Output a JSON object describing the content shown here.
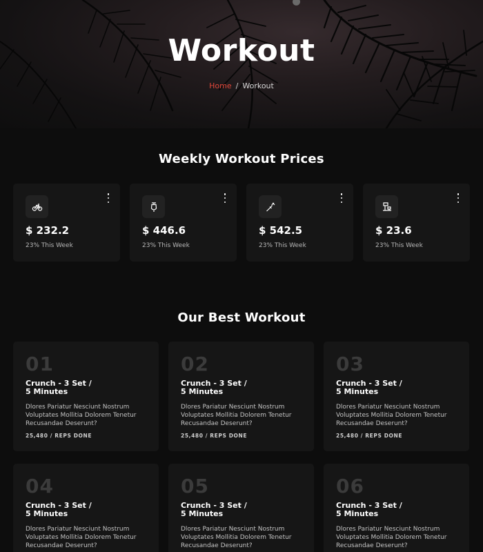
{
  "hero": {
    "title": "Workout",
    "breadcrumb": {
      "home": "Home",
      "separator": "/",
      "current": "Workout"
    }
  },
  "prices": {
    "title": "Weekly Workout Prices",
    "cards": [
      {
        "icon": "bicycle-icon",
        "value": "$ 232.2",
        "trend": "23% This Week"
      },
      {
        "icon": "kettlebell-icon",
        "value": "$ 446.6",
        "trend": "23% This Week"
      },
      {
        "icon": "jump-rope-icon",
        "value": "$ 542.5",
        "trend": "23% This Week"
      },
      {
        "icon": "exercise-machine-icon",
        "value": "$ 23.6",
        "trend": "23% This Week"
      }
    ]
  },
  "workouts": {
    "title": "Our Best Workout",
    "cards": [
      {
        "number": "01",
        "title_line1": "Crunch - 3 Set /",
        "title_line2": "5 Minutes",
        "desc": "Dlores Pariatur Nesciunt Nostrum Voluptates Mollitia Dolorem Tenetur Recusandae Deserunt?",
        "reps": "25,480 / REPS DONE"
      },
      {
        "number": "02",
        "title_line1": "Crunch - 3 Set /",
        "title_line2": "5 Minutes",
        "desc": "Dlores Pariatur Nesciunt Nostrum Voluptates Mollitia Dolorem Tenetur Recusandae Deserunt?",
        "reps": "25,480 / REPS DONE"
      },
      {
        "number": "03",
        "title_line1": "Crunch - 3 Set /",
        "title_line2": "5 Minutes",
        "desc": "Dlores Pariatur Nesciunt Nostrum Voluptates Mollitia Dolorem Tenetur Recusandae Deserunt?",
        "reps": "25,480 / REPS DONE"
      },
      {
        "number": "04",
        "title_line1": "Crunch - 3 Set /",
        "title_line2": "5 Minutes",
        "desc": "Dlores Pariatur Nesciunt Nostrum Voluptates Mollitia Dolorem Tenetur Recusandae Deserunt?",
        "reps": ""
      },
      {
        "number": "05",
        "title_line1": "Crunch - 3 Set /",
        "title_line2": "5 Minutes",
        "desc": "Dlores Pariatur Nesciunt Nostrum Voluptates Mollitia Dolorem Tenetur Recusandae Deserunt?",
        "reps": ""
      },
      {
        "number": "06",
        "title_line1": "Crunch - 3 Set /",
        "title_line2": "5 Minutes",
        "desc": "Dlores Pariatur Nesciunt Nostrum Voluptates Mollitia Dolorem Tenetur Recusandae Deserunt?",
        "reps": ""
      }
    ]
  },
  "colors": {
    "accent": "#e0473a",
    "background": "#0d0d0d",
    "card": "#161616",
    "number_muted": "#3b3b3b"
  }
}
